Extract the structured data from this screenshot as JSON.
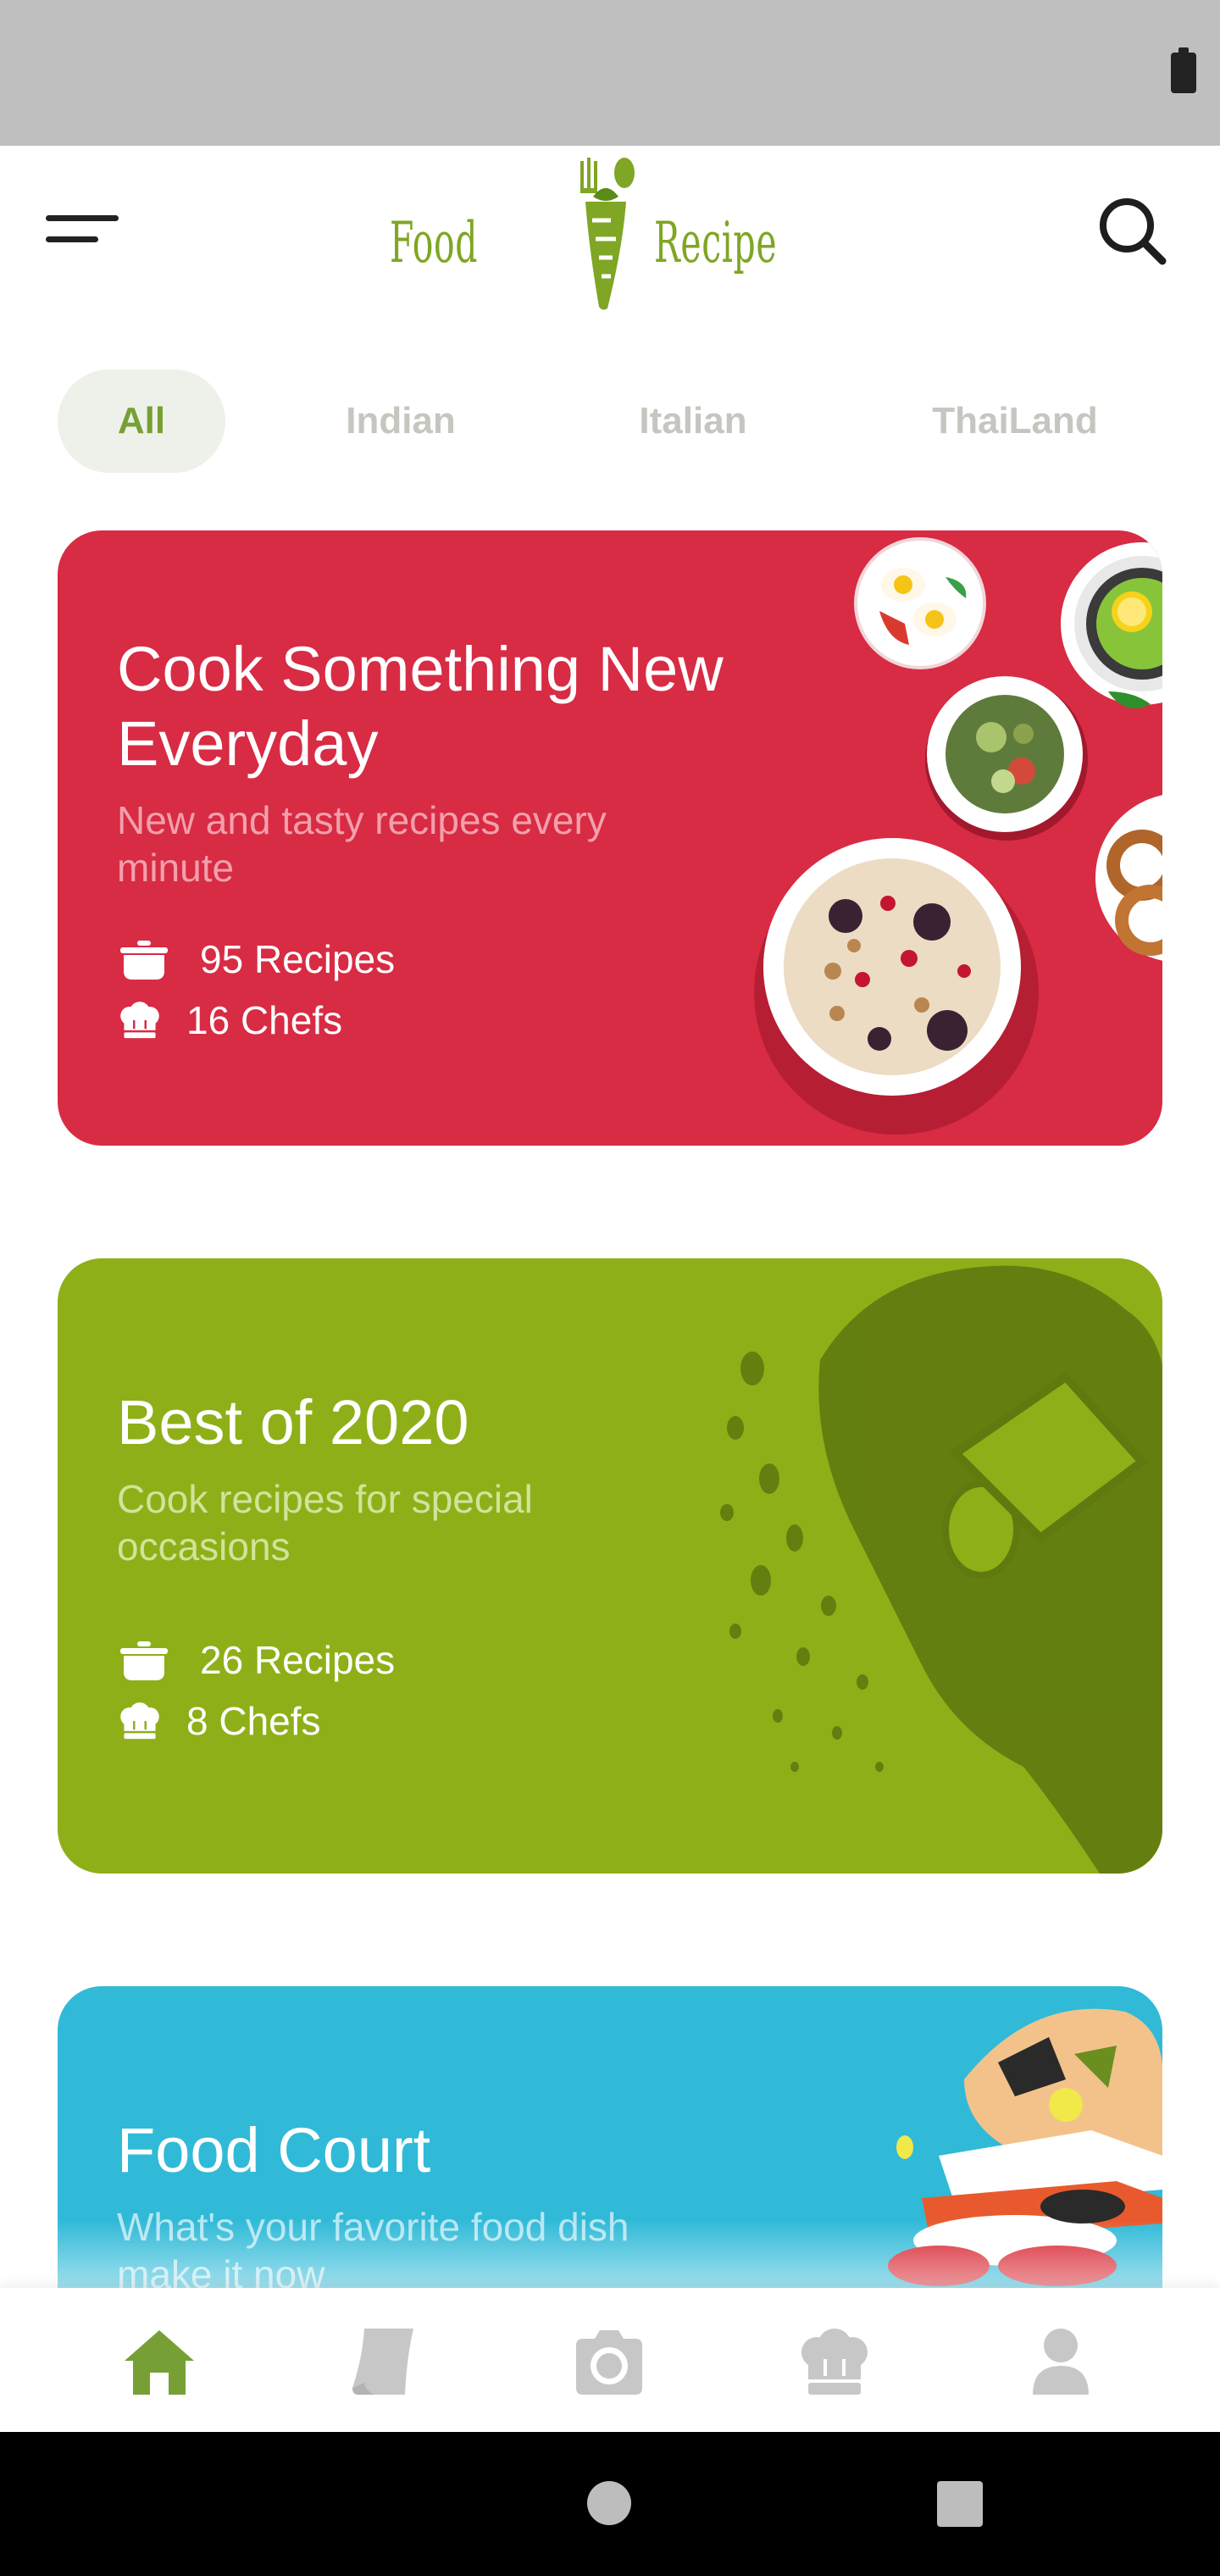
{
  "app": {
    "logo_word_1": "Food",
    "logo_word_2": "Recipe"
  },
  "colors": {
    "accent": "#76a035",
    "card_red": "#d82b44",
    "card_green": "#8faf18",
    "card_blue": "#30bad8",
    "tab_inactive": "#c4c7bf",
    "nav_inactive": "#c7c7c7"
  },
  "header": {
    "menu_icon": "hamburger-menu-icon",
    "search_icon": "search-icon"
  },
  "tabs": [
    {
      "label": "All",
      "active": true
    },
    {
      "label": "Indian",
      "active": false
    },
    {
      "label": "Italian",
      "active": false
    },
    {
      "label": "ThaiLand",
      "active": false
    }
  ],
  "cards": [
    {
      "title": "Cook Something New Everyday",
      "subtitle": "New and tasty recipes every minute",
      "recipes": "95 Recipes",
      "chefs": "16 Chefs",
      "recipes_icon": "cooking-pot-icon",
      "chefs_icon": "chef-hat-icon"
    },
    {
      "title": "Best of 2020",
      "subtitle": "Cook recipes for special occasions",
      "recipes": "26 Recipes",
      "chefs": "8 Chefs",
      "recipes_icon": "cooking-pot-icon",
      "chefs_icon": "chef-hat-icon"
    },
    {
      "title": "Food Court",
      "subtitle": "What's your favorite food dish make it now"
    }
  ],
  "bottom_nav": [
    {
      "icon": "home-icon",
      "active": true
    },
    {
      "icon": "notes-icon",
      "active": false
    },
    {
      "icon": "camera-icon",
      "active": false
    },
    {
      "icon": "chef-hat-icon",
      "active": false
    },
    {
      "icon": "profile-icon",
      "active": false
    }
  ]
}
